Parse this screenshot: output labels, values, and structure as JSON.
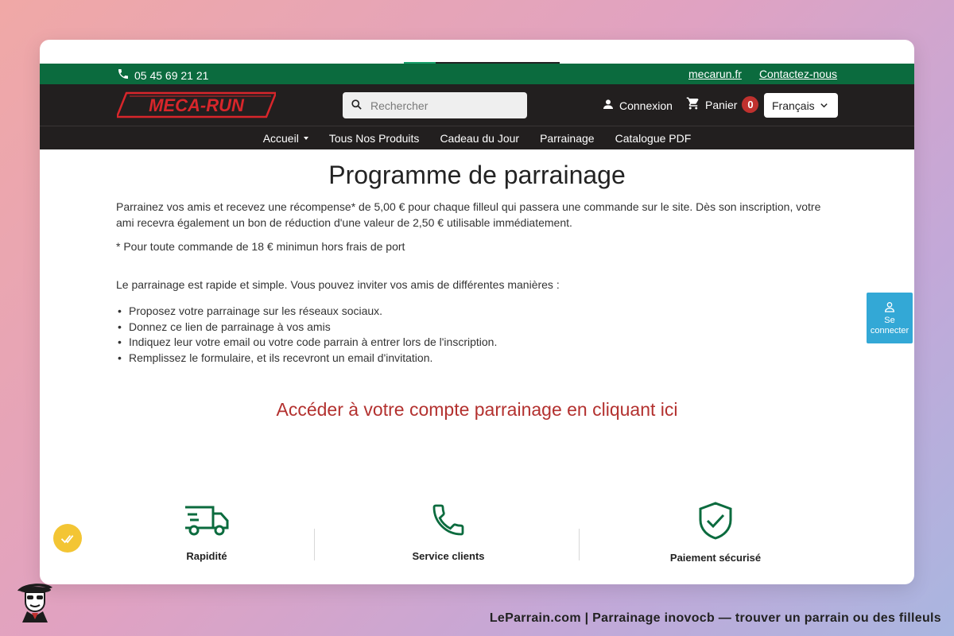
{
  "topbar": {
    "phone": "05 45 69 21 21",
    "links": [
      "mecarun.fr",
      "Contactez-nous"
    ]
  },
  "header": {
    "logo_text": "MECA-RUN",
    "search_placeholder": "Rechercher",
    "login_label": "Connexion",
    "cart_label": "Panier",
    "cart_count": "0",
    "language": "Français"
  },
  "nav": {
    "items": [
      "Accueil",
      "Tous Nos Produits",
      "Cadeau du Jour",
      "Parrainage",
      "Catalogue PDF"
    ]
  },
  "main": {
    "title": "Programme de parrainage",
    "intro": "Parrainez vos amis et recevez une récompense* de 5,00 € pour chaque filleul qui passera une commande sur le site. Dès son inscription, votre ami recevra également un bon de réduction d'une valeur de 2,50 € utilisable immédiatement.",
    "note": "* Pour toute commande de 18 € minimun hors frais de port",
    "ways": "Le parrainage est rapide et simple. Vous pouvez inviter vos amis de différentes manières :",
    "steps": [
      "Proposez votre parrainage sur les réseaux sociaux.",
      "Donnez ce lien de parrainage à vos amis",
      "Indiquez leur votre email ou votre code parrain à entrer lors de l'inscription.",
      "Remplissez le formulaire, et ils recevront un email d'invitation."
    ],
    "cta": "Accéder à votre compte parrainage en cliquant ici"
  },
  "features": [
    "Rapidité",
    "Service clients",
    "Paiement sécurisé"
  ],
  "floating": {
    "connect_line1": "Se",
    "connect_line2": "connecter"
  },
  "footer": {
    "text": "LeParrain.com | Parrainage inovocb — trouver un parrain ou des filleuls"
  },
  "colors": {
    "topbar": "#0b6b3e",
    "header": "#221f1f",
    "cta": "#b3312f",
    "badge": "#c0312e",
    "feature_icon": "#0b6b3e",
    "connect_button": "#33a8d6"
  }
}
